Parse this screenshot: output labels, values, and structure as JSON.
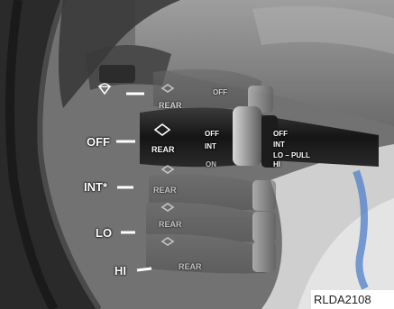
{
  "positions": [
    "OFF",
    "INT*",
    "LO",
    "HI"
  ],
  "lever_text": {
    "rear": "REAR",
    "off": "OFF",
    "int": "INT",
    "on": "ON",
    "lo_pull": "LO – PULL",
    "hi": "HI",
    "dash": "–"
  },
  "figure_code": "RLDA2108"
}
